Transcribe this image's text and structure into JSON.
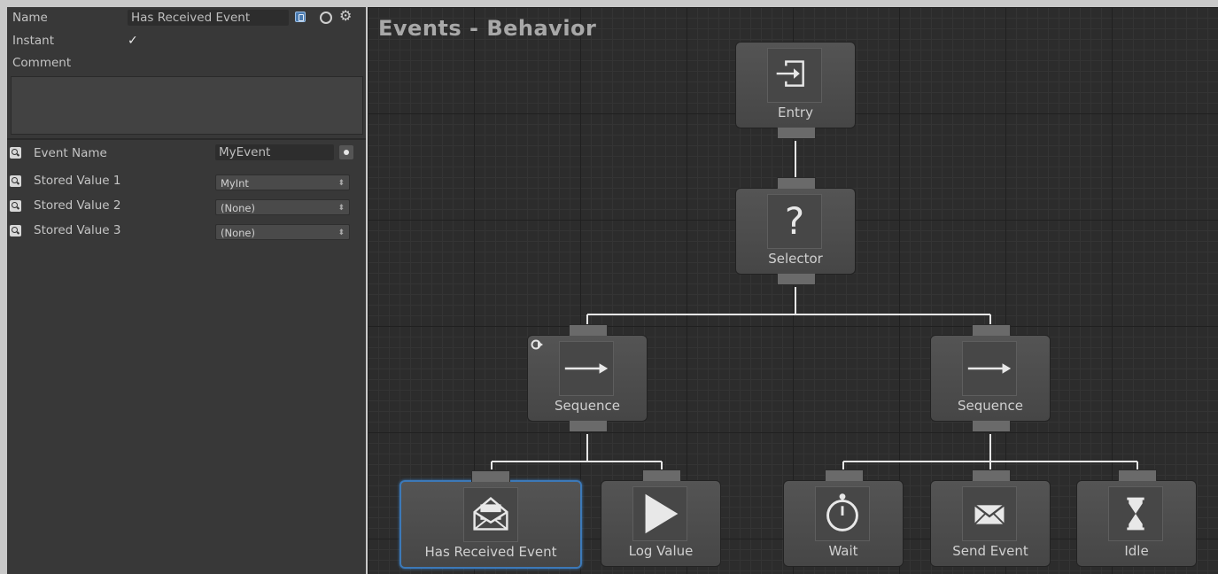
{
  "inspector": {
    "name_label": "Name",
    "name_value": "Has Received Event",
    "instant_label": "Instant",
    "instant_checked": true,
    "instant_mark": "✓",
    "comment_label": "Comment",
    "comment_value": "",
    "icons": [
      "book-icon",
      "circle-icon",
      "gear-icon"
    ],
    "properties": [
      {
        "label": "Event Name",
        "value": "MyEvent",
        "kind": "text"
      },
      {
        "label": "Stored Value 1",
        "value": "MyInt",
        "kind": "dropdown"
      },
      {
        "label": "Stored Value 2",
        "value": "(None)",
        "kind": "dropdown"
      },
      {
        "label": "Stored Value 3",
        "value": "(None)",
        "kind": "dropdown"
      }
    ]
  },
  "graph": {
    "title": "Events - Behavior",
    "nodes": [
      {
        "id": "entry",
        "label": "Entry",
        "icon": "entry-icon"
      },
      {
        "id": "selector",
        "label": "Selector",
        "icon": "question-icon"
      },
      {
        "id": "sequence-left",
        "label": "Sequence",
        "icon": "arrow-right-icon",
        "repeat": true
      },
      {
        "id": "sequence-right",
        "label": "Sequence",
        "icon": "arrow-right-icon"
      },
      {
        "id": "has-received-event",
        "label": "Has Received Event",
        "icon": "envelope-open-icon",
        "selected": true
      },
      {
        "id": "log-value",
        "label": "Log Value",
        "icon": "play-icon"
      },
      {
        "id": "wait",
        "label": "Wait",
        "icon": "stopwatch-icon"
      },
      {
        "id": "send-event",
        "label": "Send Event",
        "icon": "envelope-icon"
      },
      {
        "id": "idle",
        "label": "Idle",
        "icon": "hourglass-icon"
      }
    ],
    "selector_glyph": "?",
    "colors": {
      "background": "#2c2c2c",
      "node": "#4d4d4d",
      "wire": "#e6e6e6",
      "selection": "#3c79b8"
    }
  }
}
